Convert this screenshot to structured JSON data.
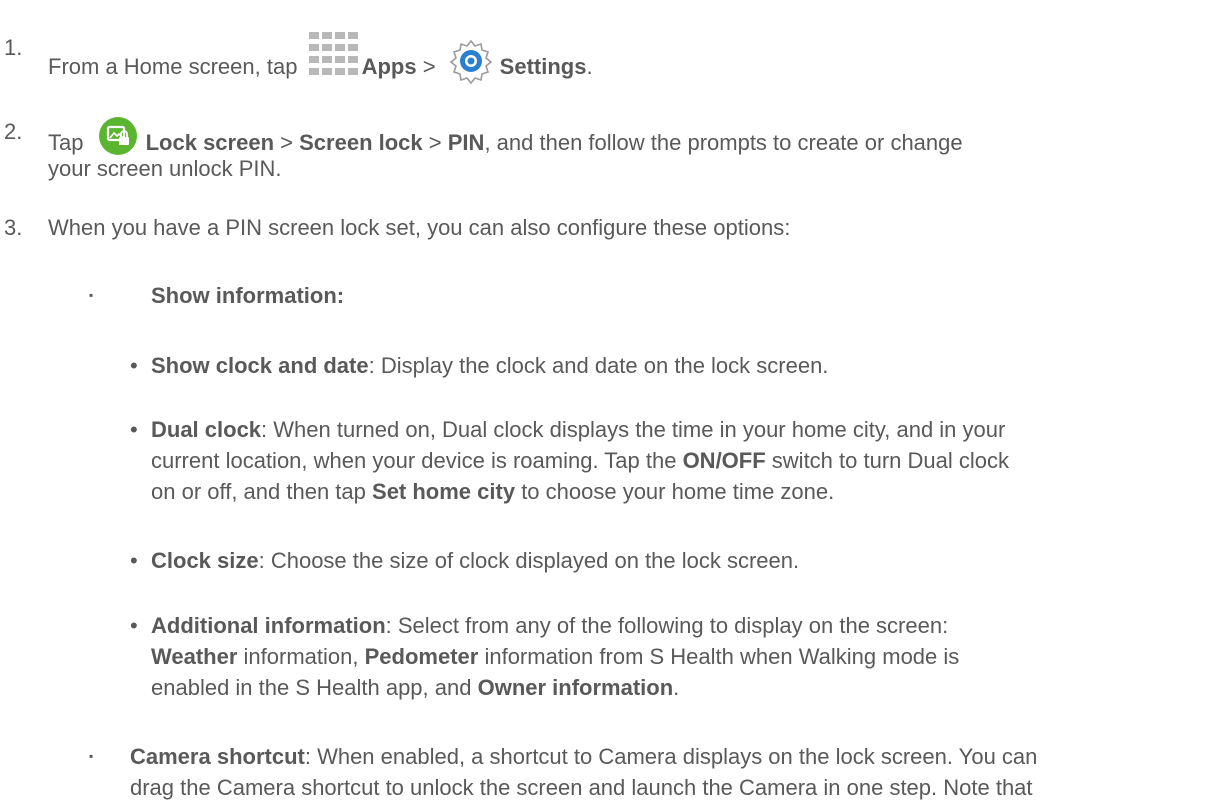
{
  "steps": {
    "s1": {
      "number": "1.",
      "pre": "From a Home screen, tap",
      "apps": "Apps",
      "gt": ">",
      "settings": "Settings",
      "end": "."
    },
    "s2": {
      "number": "2.",
      "pre": "Tap",
      "lock_screen": "Lock screen",
      "gt1": ">",
      "screen_lock": "Screen lock",
      "gt2": ">",
      "pin": "PIN",
      "rest1": ", and then follow the prompts to create or change",
      "rest2": "your screen unlock PIN."
    },
    "s3": {
      "number": "3.",
      "text": "When you have a PIN screen lock set, you can also configure these options:"
    }
  },
  "show_info": {
    "bullet": "▪",
    "label": "Show information:"
  },
  "items": {
    "clock_date": {
      "bullet": "•",
      "label": "Show clock and date",
      "text": ": Display the clock and date on the lock screen."
    },
    "dual": {
      "bullet": "•",
      "label": "Dual clock",
      "line1": ": When turned on, Dual clock displays the time in your home city, and in your",
      "line2a": "current location, when your device is roaming. Tap the",
      "onoff": "ON/OFF",
      "line2b": "switch to turn Dual clock",
      "line3a": "on or off, and then tap",
      "set_home": "Set home city",
      "line3b": "to choose your home time zone."
    },
    "clock_size": {
      "bullet": "•",
      "label": "Clock size",
      "text": ": Choose the size of clock displayed on the lock screen."
    },
    "additional": {
      "bullet": "•",
      "label": "Additional information",
      "line1": ": Select from any of the following to display on the screen:",
      "weather": "Weather",
      "l2a": "information,",
      "pedometer": "Pedometer",
      "l2b": "information from S Health when Walking mode is",
      "l3a": "enabled in the S Health app, and",
      "owner": "Owner information",
      "l3b": "."
    }
  },
  "camera": {
    "bullet": "▪",
    "label": "Camera shortcut",
    "line1": ": When enabled, a shortcut to Camera displays on the lock screen. You can",
    "line2": "drag the Camera shortcut to unlock the screen and launch the Camera in one step. Note that"
  },
  "icons": {
    "apps": "apps-grid-icon",
    "settings": "settings-gear-icon",
    "lock": "lock-screen-icon",
    "accent_green": "#5cb531",
    "accent_blue": "#2a7fd0"
  }
}
